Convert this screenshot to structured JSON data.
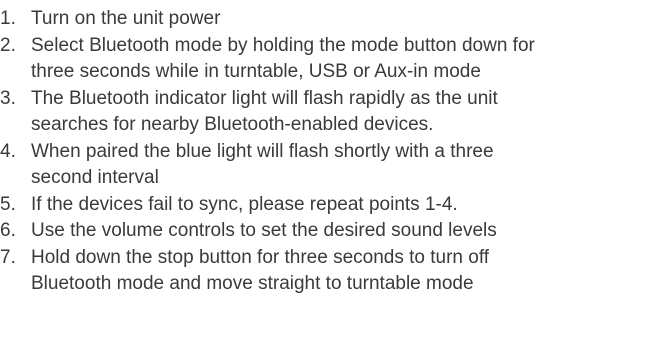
{
  "steps": [
    {
      "number": "1.",
      "lines": [
        "Turn on the unit power"
      ]
    },
    {
      "number": "2.",
      "lines": [
        "Select Bluetooth mode by holding the mode button down for",
        "three seconds while in turntable, USB or Aux-in mode"
      ]
    },
    {
      "number": "3.",
      "lines": [
        "The Bluetooth indicator light will flash rapidly as the unit",
        "searches for nearby Bluetooth-enabled devices."
      ]
    },
    {
      "number": "4.",
      "lines": [
        "When paired the blue light will flash shortly with a three",
        "second interval"
      ]
    },
    {
      "number": "5.",
      "lines": [
        "If the devices fail to sync, please repeat points 1-4."
      ]
    },
    {
      "number": "6.",
      "lines": [
        "Use the volume controls to set the desired sound levels"
      ]
    },
    {
      "number": "7.",
      "lines": [
        "Hold down the stop button for three seconds to turn off",
        "Bluetooth mode and move straight to turntable mode"
      ]
    }
  ]
}
